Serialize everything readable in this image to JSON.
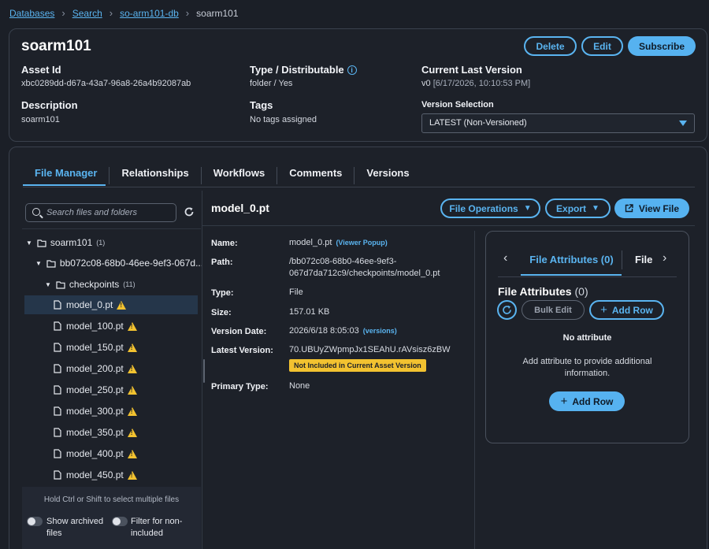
{
  "breadcrumb": {
    "items": [
      "Databases",
      "Search",
      "so-arm101-db"
    ],
    "current": "soarm101"
  },
  "header": {
    "title": "soarm101",
    "buttons": {
      "delete": "Delete",
      "edit": "Edit",
      "subscribe": "Subscribe"
    },
    "asset_id_label": "Asset Id",
    "asset_id": "xbc0289dd-d67a-43a7-96a8-26a4b92087ab",
    "type_label": "Type / Distributable",
    "type_value": "folder / Yes",
    "current_version_label": "Current Last Version",
    "current_version_value": "v0",
    "current_version_date": "[6/17/2026, 10:10:53 PM]",
    "description_label": "Description",
    "description_value": "soarm101",
    "tags_label": "Tags",
    "tags_value": "No tags assigned",
    "version_selection_label": "Version Selection",
    "version_selection_value": "LATEST (Non-Versioned)"
  },
  "tabs": [
    "File Manager",
    "Relationships",
    "Workflows",
    "Comments",
    "Versions"
  ],
  "file_manager": {
    "search_placeholder": "Search files and folders",
    "tree": {
      "root": "soarm101",
      "root_count": "(1)",
      "folder": "bb072c08-68b0-46ee-9ef3-067d...",
      "checkpoints": "checkpoints",
      "checkpoints_count": "(11)",
      "files": [
        "model_0.pt",
        "model_100.pt",
        "model_150.pt",
        "model_200.pt",
        "model_250.pt",
        "model_300.pt",
        "model_350.pt",
        "model_400.pt",
        "model_450.pt"
      ]
    },
    "hint": "Hold Ctrl or Shift to select multiple files",
    "show_archived": "Show archived files",
    "show_archived_l1": "Show archived",
    "show_archived_l2": "files",
    "filter_l1": "Filter for non-",
    "filter_l2": "included"
  },
  "detail": {
    "title": "model_0.pt",
    "buttons": {
      "file_operations": "File Operations",
      "export": "Export",
      "view_file": "View File"
    },
    "name_label": "Name:",
    "name_value": "model_0.pt",
    "viewer_popup": "(Viewer Popup)",
    "path_label": "Path:",
    "path_l1": "/bb072c08-68b0-46ee-9ef3-",
    "path_l2": "067d7da712c9/checkpoints/model_0.pt",
    "type_label": "Type:",
    "type_value": "File",
    "size_label": "Size:",
    "size_value": "157.01 KB",
    "version_date_label": "Version Date:",
    "version_date_value": "2026/6/18 8:05:03",
    "versions_link": "(versions)",
    "latest_version_label": "Latest Version:",
    "latest_version_value": "70.UBUyZWpmpJx1SEAhU.rAVsisz6zBW",
    "not_included_badge": "Not Included in Current Asset Version",
    "primary_type_label": "Primary Type:",
    "primary_type_value": "None"
  },
  "attributes": {
    "tab_active": "File Attributes (0)",
    "tab_next": "File",
    "title": "File Attributes",
    "count": "(0)",
    "bulk_edit": "Bulk Edit",
    "add_row": "Add Row",
    "no_attribute": "No attribute",
    "empty_l1": "Add attribute to provide additional",
    "empty_l2": "information.",
    "add_row_bottom": "Add Row"
  },
  "colors": {
    "accent": "#5ab4f0",
    "warning": "#f2c230",
    "background": "#1b1f27"
  }
}
